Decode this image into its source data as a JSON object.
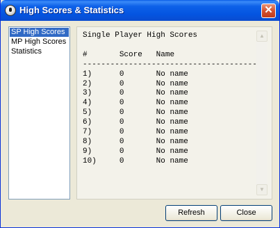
{
  "window": {
    "title": "High Scores & Statistics"
  },
  "sidebar": {
    "items": [
      {
        "label": "SP High Scores",
        "selected": true
      },
      {
        "label": "MP High Scores",
        "selected": false
      },
      {
        "label": "Statistics",
        "selected": false
      }
    ]
  },
  "content": {
    "heading": "Single Player High Scores",
    "columns": [
      "#",
      "Score",
      "Name"
    ],
    "separator": "----------------------------------------",
    "rows": [
      {
        "rank": "1)",
        "score": "0",
        "name": "No name"
      },
      {
        "rank": "2)",
        "score": "0",
        "name": "No name"
      },
      {
        "rank": "3)",
        "score": "0",
        "name": "No name"
      },
      {
        "rank": "4)",
        "score": "0",
        "name": "No name"
      },
      {
        "rank": "5)",
        "score": "0",
        "name": "No name"
      },
      {
        "rank": "6)",
        "score": "0",
        "name": "No name"
      },
      {
        "rank": "7)",
        "score": "0",
        "name": "No name"
      },
      {
        "rank": "8)",
        "score": "0",
        "name": "No name"
      },
      {
        "rank": "9)",
        "score": "0",
        "name": "No name"
      },
      {
        "rank": "10)",
        "score": "0",
        "name": "No name"
      }
    ]
  },
  "buttons": {
    "refresh": "Refresh",
    "close": "Close"
  },
  "icons": {
    "app": "app-info-icon",
    "close": "close-icon"
  },
  "colors": {
    "titlebar": "#0454e0",
    "selection": "#316ac5",
    "close_button": "#d4502f"
  }
}
